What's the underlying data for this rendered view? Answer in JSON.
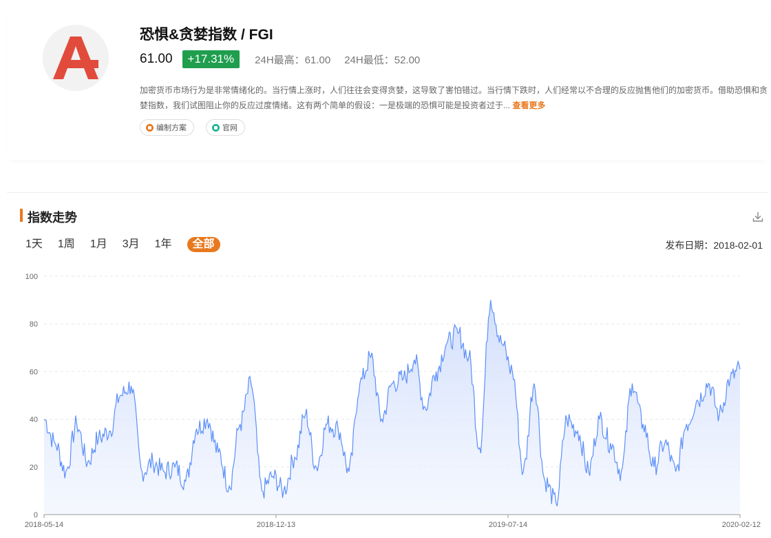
{
  "header": {
    "title": "恐惧&贪婪指数 / FGI",
    "price": "61.00",
    "change": "+17.31%",
    "high": "24H最高：61.00",
    "low": "24H最低：52.00",
    "description": "加密货币市场行为是非常情绪化的。当行情上涨时，人们往往会变得贪婪，这导致了害怕错过。当行情下跌时，人们经常以不合理的反应抛售他们的加密货币。借助恐惧和贪婪指数，我们试图阻止你的反应过度情绪。这有两个简单的假设：一是极端的恐惧可能是投资者过于...",
    "more": "查看更多",
    "tags": [
      {
        "label": "编制方案",
        "color": "#e8791f"
      },
      {
        "label": "官网",
        "color": "#1fb58f"
      }
    ],
    "logo_color": "#e14b3b"
  },
  "section": {
    "title": "指数走势",
    "ranges": [
      "1天",
      "1周",
      "1月",
      "3月",
      "1年",
      "全部"
    ],
    "active_range": "全部",
    "publish_date": "发布日期：2018-02-01"
  },
  "chart_data": {
    "type": "area",
    "x_start": "2018-05-14",
    "x_end": "2020-02-12",
    "x_ticks": [
      "2018-05-14",
      "2018-12-13",
      "2019-07-14",
      "2020-02-12"
    ],
    "ylim": [
      0,
      100
    ],
    "y_ticks": [
      0,
      20,
      40,
      60,
      80,
      100
    ],
    "grid": true,
    "line_color": "#5b8ff9",
    "fill_color": "#dfe8fd",
    "series_monthly": [
      {
        "date": "2018-05-14",
        "value": 40
      },
      {
        "date": "2018-05-24",
        "value": 30
      },
      {
        "date": "2018-06-03",
        "value": 18
      },
      {
        "date": "2018-06-13",
        "value": 38
      },
      {
        "date": "2018-06-23",
        "value": 22
      },
      {
        "date": "2018-07-03",
        "value": 32
      },
      {
        "date": "2018-07-13",
        "value": 35
      },
      {
        "date": "2018-07-23",
        "value": 50
      },
      {
        "date": "2018-08-02",
        "value": 54
      },
      {
        "date": "2018-08-12",
        "value": 18
      },
      {
        "date": "2018-08-22",
        "value": 22
      },
      {
        "date": "2018-09-01",
        "value": 18
      },
      {
        "date": "2018-09-11",
        "value": 20
      },
      {
        "date": "2018-09-21",
        "value": 14
      },
      {
        "date": "2018-10-01",
        "value": 36
      },
      {
        "date": "2018-10-11",
        "value": 40
      },
      {
        "date": "2018-10-21",
        "value": 26
      },
      {
        "date": "2018-10-31",
        "value": 12
      },
      {
        "date": "2018-11-10",
        "value": 38
      },
      {
        "date": "2018-11-20",
        "value": 55
      },
      {
        "date": "2018-11-30",
        "value": 10
      },
      {
        "date": "2018-12-10",
        "value": 16
      },
      {
        "date": "2018-12-20",
        "value": 10
      },
      {
        "date": "2018-12-30",
        "value": 24
      },
      {
        "date": "2019-01-09",
        "value": 42
      },
      {
        "date": "2019-01-19",
        "value": 20
      },
      {
        "date": "2019-01-29",
        "value": 38
      },
      {
        "date": "2019-02-08",
        "value": 36
      },
      {
        "date": "2019-02-18",
        "value": 18
      },
      {
        "date": "2019-02-28",
        "value": 55
      },
      {
        "date": "2019-03-10",
        "value": 66
      },
      {
        "date": "2019-03-20",
        "value": 40
      },
      {
        "date": "2019-03-30",
        "value": 55
      },
      {
        "date": "2019-04-09",
        "value": 57
      },
      {
        "date": "2019-04-19",
        "value": 65
      },
      {
        "date": "2019-04-29",
        "value": 45
      },
      {
        "date": "2019-05-09",
        "value": 60
      },
      {
        "date": "2019-05-19",
        "value": 72
      },
      {
        "date": "2019-05-29",
        "value": 76
      },
      {
        "date": "2019-06-08",
        "value": 66
      },
      {
        "date": "2019-06-18",
        "value": 28
      },
      {
        "date": "2019-06-28",
        "value": 90
      },
      {
        "date": "2019-07-08",
        "value": 72
      },
      {
        "date": "2019-07-18",
        "value": 60
      },
      {
        "date": "2019-07-28",
        "value": 18
      },
      {
        "date": "2019-08-07",
        "value": 55
      },
      {
        "date": "2019-08-17",
        "value": 14
      },
      {
        "date": "2019-08-27",
        "value": 5
      },
      {
        "date": "2019-09-06",
        "value": 40
      },
      {
        "date": "2019-09-16",
        "value": 35
      },
      {
        "date": "2019-09-26",
        "value": 18
      },
      {
        "date": "2019-10-06",
        "value": 40
      },
      {
        "date": "2019-10-16",
        "value": 30
      },
      {
        "date": "2019-10-26",
        "value": 18
      },
      {
        "date": "2019-11-05",
        "value": 55
      },
      {
        "date": "2019-11-15",
        "value": 38
      },
      {
        "date": "2019-11-25",
        "value": 20
      },
      {
        "date": "2019-12-05",
        "value": 30
      },
      {
        "date": "2019-12-15",
        "value": 18
      },
      {
        "date": "2019-12-25",
        "value": 38
      },
      {
        "date": "2020-01-04",
        "value": 48
      },
      {
        "date": "2020-01-14",
        "value": 55
      },
      {
        "date": "2020-01-24",
        "value": 42
      },
      {
        "date": "2020-02-03",
        "value": 57
      },
      {
        "date": "2020-02-12",
        "value": 61
      }
    ]
  }
}
